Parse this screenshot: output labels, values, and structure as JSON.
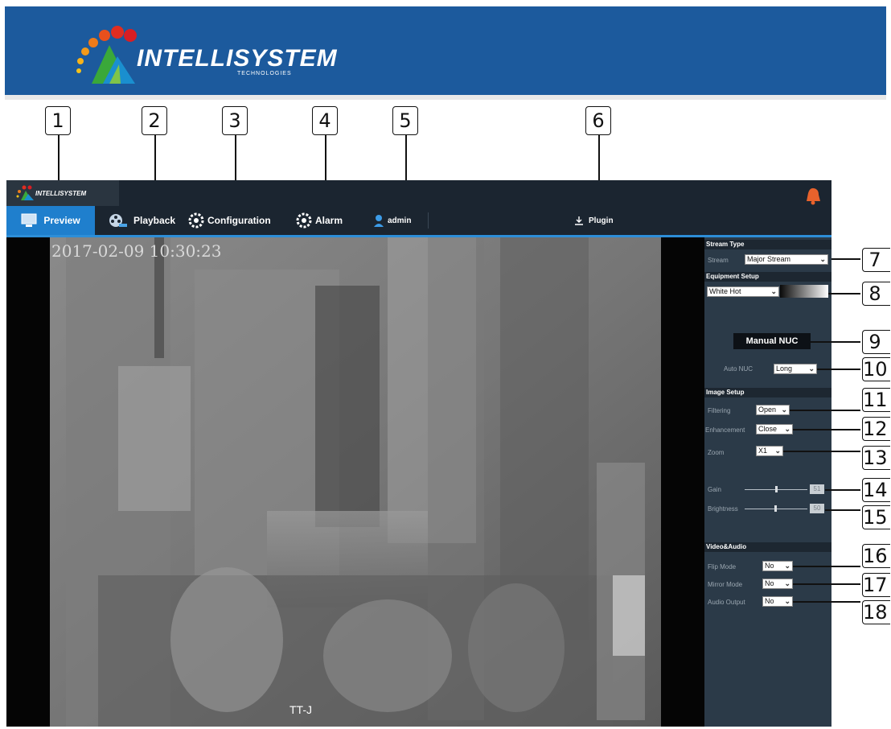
{
  "banner": {
    "brand": "INTELLISYSTEM",
    "sub": "TECHNOLOGIES"
  },
  "callouts": [
    "1",
    "2",
    "3",
    "4",
    "5",
    "6",
    "7",
    "8",
    "9",
    "10",
    "11",
    "12",
    "13",
    "14",
    "15",
    "16",
    "17",
    "18"
  ],
  "app": {
    "logo_text": "INTELLISYSTEM",
    "nav": {
      "preview": "Preview",
      "playback": "Playback",
      "configuration": "Configuration",
      "alarm": "Alarm",
      "user": "admin",
      "plugin": "Plugin"
    }
  },
  "video": {
    "timestamp": "2017-02-09 10:30:23",
    "channel": "TT-J"
  },
  "panel": {
    "stream_type": {
      "title": "Stream Type",
      "label": "Stream",
      "value": "Major Stream"
    },
    "equipment": {
      "title": "Equipment Setup",
      "palette": "White Hot",
      "manual_nuc": "Manual NUC",
      "auto_nuc_label": "Auto NUC",
      "auto_nuc_value": "Long"
    },
    "image": {
      "title": "Image Setup",
      "filtering_label": "Filtering",
      "filtering_value": "Open",
      "enhancement_label": "Enhancement",
      "enhancement_value": "Close",
      "zoom_label": "Zoom",
      "zoom_value": "X1",
      "gain_label": "Gain",
      "gain_value": "51",
      "brightness_label": "Brightness",
      "brightness_value": "50"
    },
    "va": {
      "title": "Video&Audio",
      "flip_label": "Flip Mode",
      "flip_value": "No",
      "mirror_label": "Mirror Mode",
      "mirror_value": "No",
      "audio_label": "Audio Output",
      "audio_value": "No"
    }
  },
  "colors": {
    "banner": "#1c5a9d",
    "nav_active": "#1f7fcd",
    "panel": "#2b3a48"
  }
}
